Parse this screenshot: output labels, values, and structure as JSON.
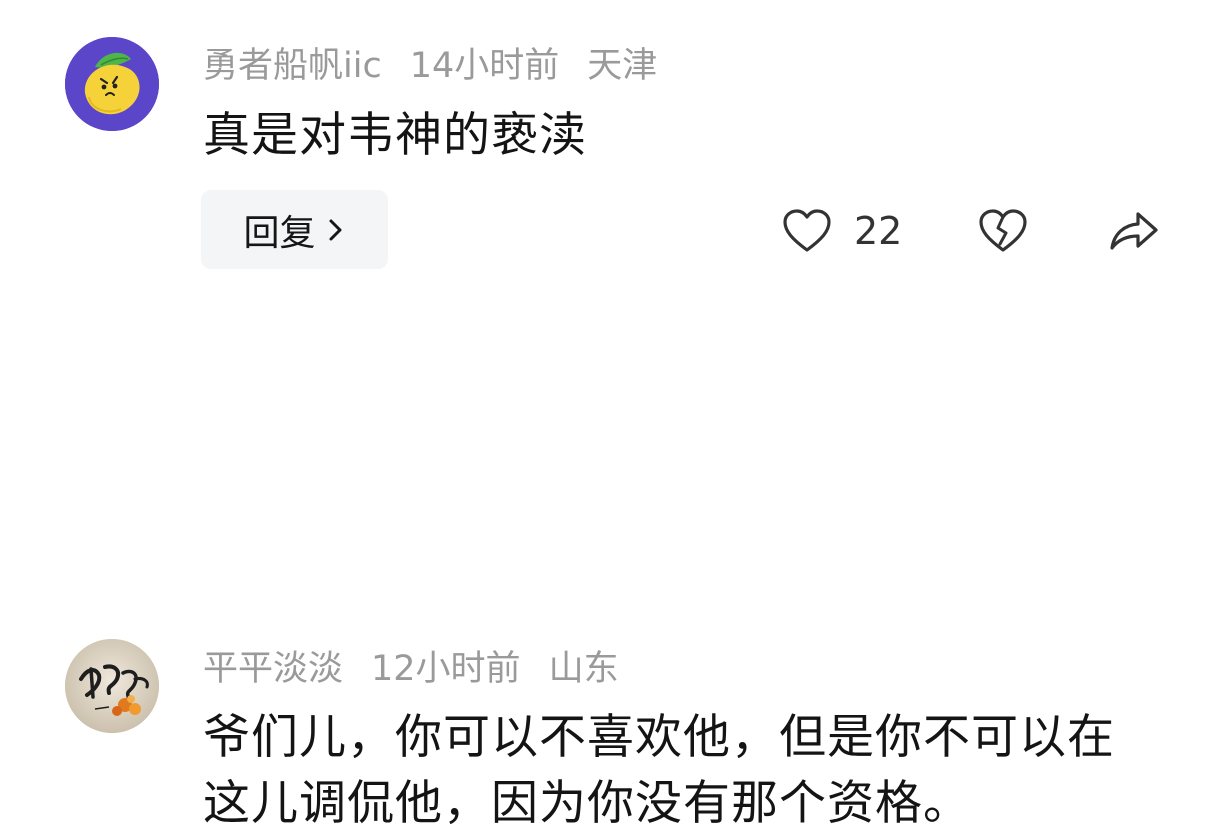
{
  "comments": [
    {
      "username": "勇者船帆iic",
      "time": "14小时前",
      "location": "天津",
      "text": "真是对韦神的亵渎",
      "reply_label": "回复",
      "like_count": "22",
      "avatar_icon": "lemon-avatar-icon"
    },
    {
      "username": "平平淡淡",
      "time": "12小时前",
      "location": "山东",
      "text": "爷们儿，你可以不喜欢他，但是你不可以在这儿调侃他，因为你没有那个资格。",
      "avatar_icon": "calligraphy-avatar-icon"
    }
  ],
  "icons": {
    "like": "heart-icon",
    "dislike": "broken-heart-icon",
    "share": "share-arrow-icon",
    "reply_chevron": "chevron-right-icon"
  },
  "colors": {
    "meta_text": "#9a9a9a",
    "body_text": "#141414",
    "reply_bg": "#f4f5f6",
    "icon_stroke": "#333333"
  }
}
